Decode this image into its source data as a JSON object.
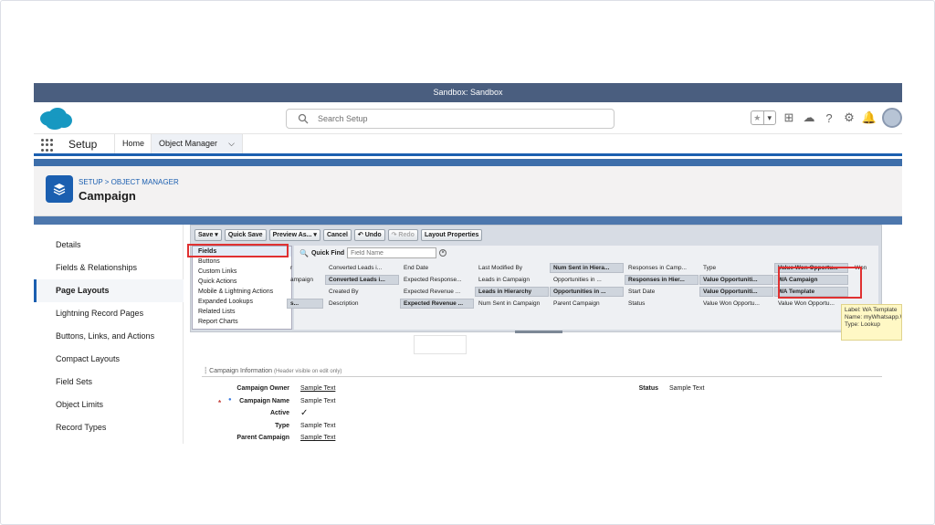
{
  "sandbox_bar": "Sandbox: Sandbox",
  "search": {
    "placeholder": "Search Setup"
  },
  "nav": {
    "app_name": "Setup",
    "tabs": [
      "Home",
      "Object Manager"
    ]
  },
  "page_header": {
    "breadcrumb": "SETUP > OBJECT MANAGER",
    "title": "Campaign"
  },
  "sidebar": {
    "items": [
      "Details",
      "Fields & Relationships",
      "Page Layouts",
      "Lightning Record Pages",
      "Buttons, Links, and Actions",
      "Compact Layouts",
      "Field Sets",
      "Object Limits",
      "Record Types"
    ],
    "active_index": 2
  },
  "toolbar": {
    "buttons": [
      "Save ▾",
      "Quick Save",
      "Preview As... ▾",
      "Cancel",
      "↶ Undo",
      "↷ Redo",
      "Layout Properties"
    ]
  },
  "palette": {
    "categories": [
      "Fields",
      "Buttons",
      "Custom Links",
      "Quick Actions",
      "Mobile & Lightning Actions",
      "Expanded Lookups",
      "Related Lists",
      "Report Charts"
    ],
    "selected_category": "Fields",
    "quick_find_label": "Quick Find",
    "quick_find_placeholder": "Field Name",
    "field_rows": [
      [
        "r",
        "Converted Leads i...",
        "End Date",
        "Last Modified By",
        "Num Sent in Hiera...",
        "Responses in Camp...",
        "Type",
        "Value Won Opportu...",
        "Won"
      ],
      [
        "ampaign",
        "Converted Leads i...",
        "Expected Response...",
        "Leads in Campaign",
        "Opportunities in ...",
        "Responses in Hier...",
        "Value Opportuniti...",
        "WA Campaign",
        ""
      ],
      [
        "",
        "Created By",
        "Expected Revenue ...",
        "Leads in Hierarchy",
        "Opportunities in ...",
        "Start Date",
        "Value Opportuniti...",
        "WA Template",
        ""
      ],
      [
        "s...",
        "Description",
        "Expected Revenue ...",
        "Num Sent in Campaign",
        "Parent Campaign",
        "Status",
        "Value Won Opportu...",
        "Value Won Opportu...",
        ""
      ]
    ],
    "used_cells": [
      "0-4",
      "0-7",
      "1-1",
      "1-5",
      "1-6",
      "1-7",
      "2-3",
      "2-4",
      "2-6",
      "2-7",
      "3-0",
      "3-2"
    ],
    "tooltip": [
      "Label: WA Template",
      "Name: myWhatsapp.WA_",
      "Type: Lookup"
    ]
  },
  "layout_section": {
    "title": "Campaign Information",
    "note": "(Header visible on edit only)",
    "left_fields": [
      {
        "label": "Campaign Owner",
        "value": "Sample Text",
        "link": true
      },
      {
        "label": "Campaign Name",
        "value": "Sample Text",
        "link": false
      },
      {
        "label": "Active",
        "value": "✓",
        "link": false
      },
      {
        "label": "Type",
        "value": "Sample Text",
        "link": false
      },
      {
        "label": "Parent Campaign",
        "value": "Sample Text",
        "link": true
      }
    ],
    "right_fields": [
      {
        "label": "Status",
        "value": "Sample Text",
        "link": false
      }
    ]
  },
  "colors": {
    "brand_blue": "#1b5fb0",
    "highlight_red": "#e03131",
    "sandbox_bar": "#4a5e7f"
  }
}
